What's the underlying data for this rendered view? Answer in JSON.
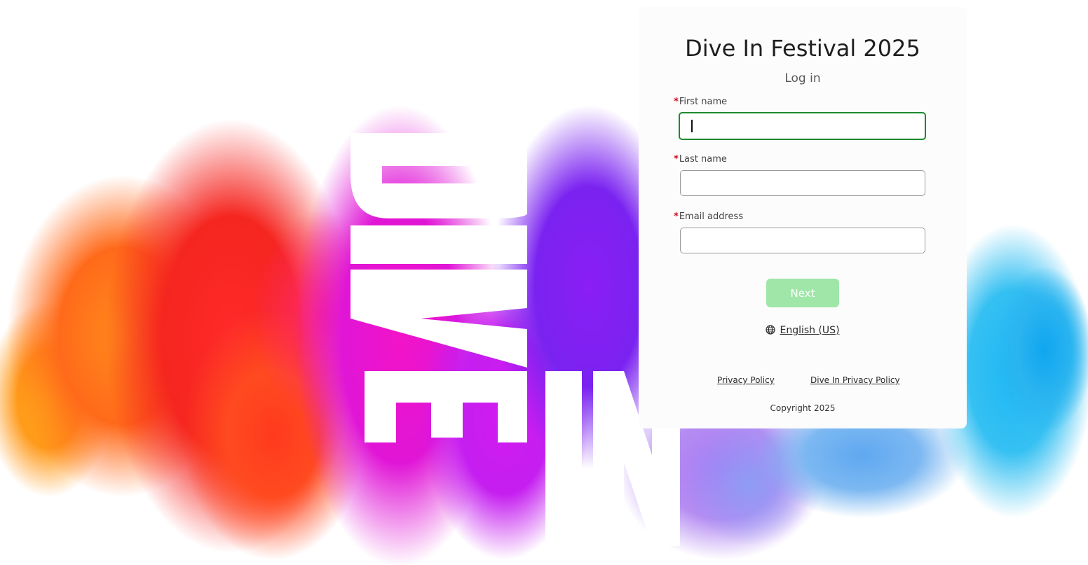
{
  "hero": {
    "brand_text": "DIVE IN"
  },
  "card": {
    "title": "Dive In Festival 2025",
    "subtitle": "Log in",
    "required_marker": "*",
    "fields": [
      {
        "label": "First name",
        "value": "",
        "placeholder": ""
      },
      {
        "label": "Last name",
        "value": "",
        "placeholder": ""
      },
      {
        "label": "Email address",
        "value": "",
        "placeholder": ""
      }
    ],
    "next_label": "Next",
    "language": "English (US)",
    "privacy_policy": "Privacy Policy",
    "dive_in_privacy_policy": "Dive In Privacy Policy",
    "copyright": "Copyright 2025"
  },
  "colors": {
    "focus_border": "#1e8a2e",
    "next_button_disabled": "#9fe6a8",
    "required_asterisk": "#d0021b"
  },
  "icons": {
    "language": "globe-icon"
  }
}
